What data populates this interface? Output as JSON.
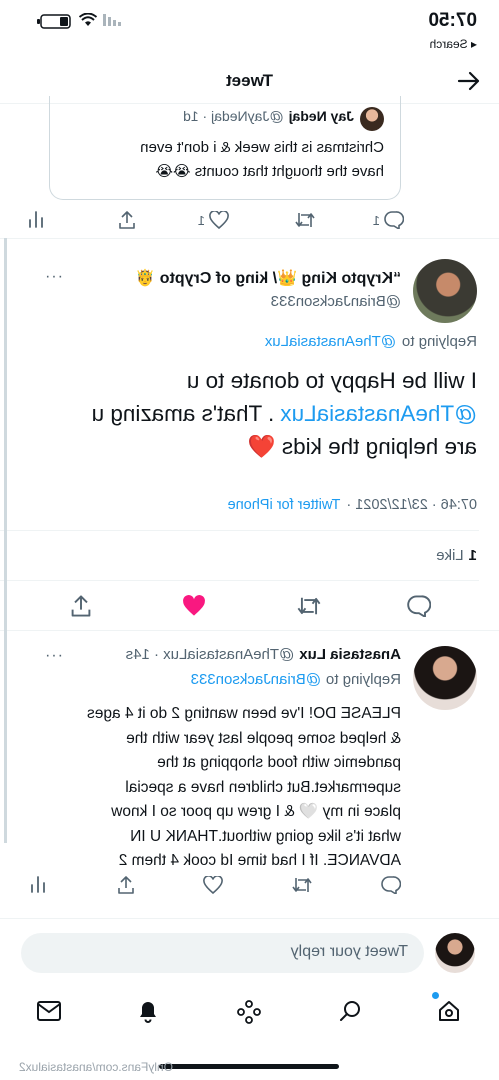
{
  "status_bar": {
    "time": "07:50",
    "back_label": "◂ Search"
  },
  "header": {
    "title": "Tweet"
  },
  "prev_tweet": {
    "name": "Jay Nedaj",
    "handle": "@JayNedaj · 1d",
    "text_line1": "Christmas is this week & i don't even",
    "text_line2": "have the thought that counts 😭😭",
    "reply_count": "1",
    "like_count": "1"
  },
  "main_tweet": {
    "name": "“Krypto King 👑/ king of Crypto 🤴",
    "handle": "@BrianJackson333",
    "replying_prefix": "Replying to",
    "replying_to": "@TheAnastasiaLux",
    "text_line1": "I will be Happy to donate to u",
    "text_mention": "@TheAnastasiaLux",
    "text_line2_rest": ".  That's amazing u",
    "text_line3": "are helping the kids ❤️",
    "meta": "07:46 · 23/12/2021 ·",
    "source": "Twitter for iPhone",
    "like_count": "1",
    "like_label": "Like"
  },
  "reply_tweet": {
    "name": "Anastasia Lux",
    "handle": "@TheAnastasiaLux · 14s",
    "replying_prefix": "Replying to",
    "replying_to": "@BrianJackson333",
    "lines": [
      "PLEASE DO! I've been wanting 2 do it 4 ages",
      "& helped some people last year with the",
      "pandemic with food shopping at the",
      "supermarket.But children have a special",
      "place in my 🤍 & I grew up poor so I know",
      "what it's like going without.THANK U IN",
      "ADVANCE. If I had time Id cook 4 them 2"
    ]
  },
  "reply_box": {
    "placeholder": "Tweet your reply"
  },
  "watermark": "OnlyFans.com/anastasialux2",
  "colors": {
    "accent": "#1d9bf0",
    "like": "#f91880",
    "text": "#0f1419",
    "secondary": "#536471"
  }
}
